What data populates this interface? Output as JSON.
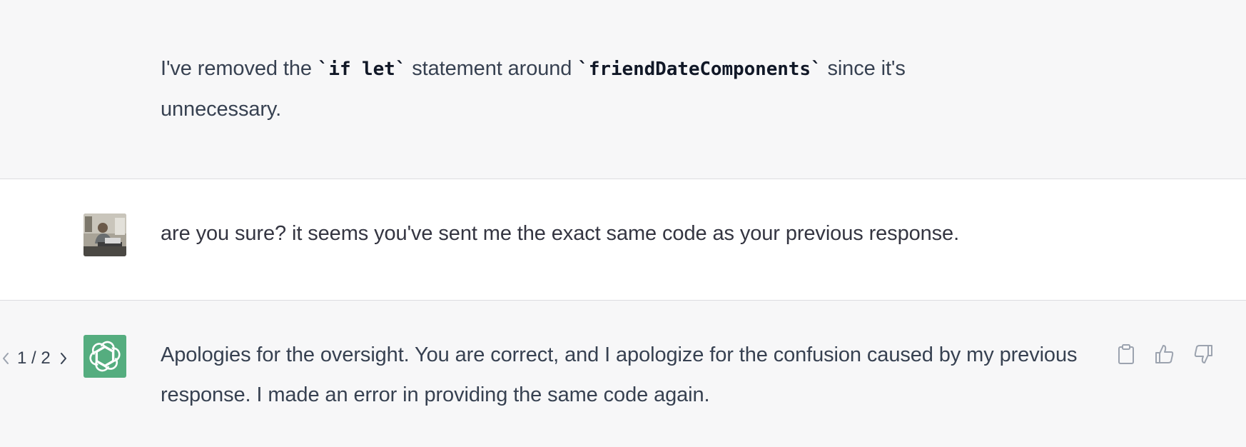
{
  "messages": [
    {
      "role": "assistant",
      "parts": [
        "I've removed the ",
        "`if let`",
        " statement around ",
        "`friendDateComponents`",
        " since it's unnecessary."
      ]
    },
    {
      "role": "user",
      "avatar_icon": "user-photo-avatar",
      "text": "are you sure? it seems you've sent me the exact same code as your previous response."
    },
    {
      "role": "assistant",
      "avatar_icon": "openai-logo-icon",
      "text": "Apologies for the oversight. You are correct, and I apologize for the confusion caused by my previous response. I made an error in providing the same code again.",
      "pager": {
        "label": "1 / 2",
        "prev_icon": "chevron-left-icon",
        "next_icon": "chevron-right-icon"
      },
      "actions": [
        {
          "icon": "clipboard-icon"
        },
        {
          "icon": "thumbs-up-icon"
        },
        {
          "icon": "thumbs-down-icon"
        }
      ]
    }
  ],
  "colors": {
    "assistant_bg": "#f7f7f8",
    "user_bg": "#ffffff",
    "gpt_brand": "#55ad7f",
    "text": "#374151"
  }
}
